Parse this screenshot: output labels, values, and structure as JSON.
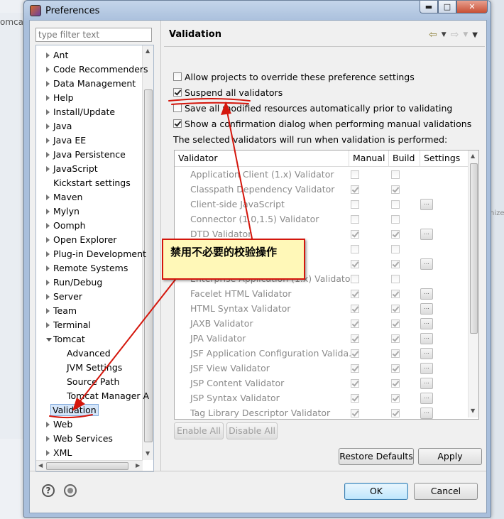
{
  "window": {
    "title": "Preferences"
  },
  "filter": {
    "placeholder": "type filter text"
  },
  "tree": {
    "items": [
      "Ant",
      "Code Recommenders",
      "Data Management",
      "Help",
      "Install/Update",
      "Java",
      "Java EE",
      "Java Persistence",
      "JavaScript",
      "Kickstart settings",
      "Maven",
      "Mylyn",
      "Oomph",
      "Open Explorer",
      "Plug-in Development",
      "Remote Systems",
      "Run/Debug",
      "Server",
      "Team",
      "Terminal",
      "Tomcat"
    ],
    "tomcat_children": [
      "Advanced",
      "JVM Settings",
      "Source Path",
      "Tomcat Manager A"
    ],
    "selected": "Validation",
    "after": [
      "Web",
      "Web Services",
      "XML"
    ]
  },
  "page": {
    "title": "Validation",
    "options": [
      {
        "label": "Allow projects to override these preference settings",
        "checked": false
      },
      {
        "label": "Suspend all validators",
        "checked": true
      },
      {
        "label": "Save all modified resources automatically prior to validating",
        "checked": false
      },
      {
        "label": "Show a confirmation dialog when performing manual validations",
        "checked": true
      }
    ],
    "info": "The selected validators will run when validation is performed:"
  },
  "validators": {
    "headers": [
      "Validator",
      "Manual",
      "Build",
      "Settings"
    ],
    "rows": [
      {
        "name": "Application Client (1.x) Validator",
        "manual": false,
        "build": false,
        "settings": false
      },
      {
        "name": "Classpath Dependency Validator",
        "manual": true,
        "build": true,
        "settings": false
      },
      {
        "name": "Client-side JavaScript",
        "manual": false,
        "build": false,
        "settings": true
      },
      {
        "name": "Connector (1.0,1.5) Validator",
        "manual": false,
        "build": false,
        "settings": false
      },
      {
        "name": "DTD Validator",
        "manual": true,
        "build": true,
        "settings": true
      },
      {
        "name": "",
        "manual": false,
        "build": false,
        "settings": false
      },
      {
        "name": "",
        "manual": true,
        "build": true,
        "settings": true
      },
      {
        "name": "Enterprise Application (1.x) Validator",
        "manual": false,
        "build": false,
        "settings": false
      },
      {
        "name": "Facelet HTML Validator",
        "manual": true,
        "build": true,
        "settings": true
      },
      {
        "name": "HTML Syntax Validator",
        "manual": true,
        "build": true,
        "settings": true
      },
      {
        "name": "JAXB Validator",
        "manual": true,
        "build": true,
        "settings": true
      },
      {
        "name": "JPA Validator",
        "manual": true,
        "build": true,
        "settings": true
      },
      {
        "name": "JSF Application Configuration Valida...",
        "manual": true,
        "build": true,
        "settings": true
      },
      {
        "name": "JSF View Validator",
        "manual": true,
        "build": true,
        "settings": true
      },
      {
        "name": "JSP Content Validator",
        "manual": true,
        "build": true,
        "settings": true
      },
      {
        "name": "JSP Syntax Validator",
        "manual": true,
        "build": true,
        "settings": true
      },
      {
        "name": "Tag Library Descriptor Validator",
        "manual": true,
        "build": true,
        "settings": true
      }
    ]
  },
  "buttons": {
    "enable_all": "Enable All",
    "disable_all": "Disable All",
    "restore_defaults": "Restore Defaults",
    "apply": "Apply",
    "ok": "OK",
    "cancel": "Cancel"
  },
  "annotation": {
    "text": "禁用不必要的校验操作",
    "color": "#d4160c"
  },
  "background": {
    "tab": "omcat",
    "tab_right": "nize"
  }
}
